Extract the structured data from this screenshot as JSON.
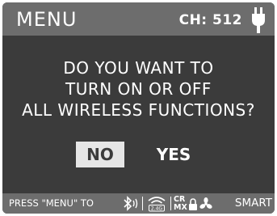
{
  "header": {
    "title": "MENU",
    "channel_label": "CH: 512",
    "power_icon": "plug-icon"
  },
  "dialog": {
    "lines": [
      "DO YOU WANT TO",
      "TURN ON OR OFF",
      "ALL WIRELESS FUNCTIONS?"
    ],
    "no_label": "NO",
    "yes_label": "YES",
    "selected": "NO"
  },
  "footer": {
    "hint": "PRESS \"MENU\" TO",
    "icons": [
      "bluetooth-icon",
      "wifi-2.4g-icon",
      "crmx-icon",
      "lock-icon",
      "fan-icon"
    ],
    "wifi_band_label": "2.4G",
    "crmx_label_top": "CR",
    "crmx_label_bottom": "MX",
    "smart_label": "SMART"
  },
  "colors": {
    "background": "#3b3b3b",
    "bar": "#6d6d6d",
    "text": "#ffffff",
    "selected_button": "#e6e6e6"
  }
}
